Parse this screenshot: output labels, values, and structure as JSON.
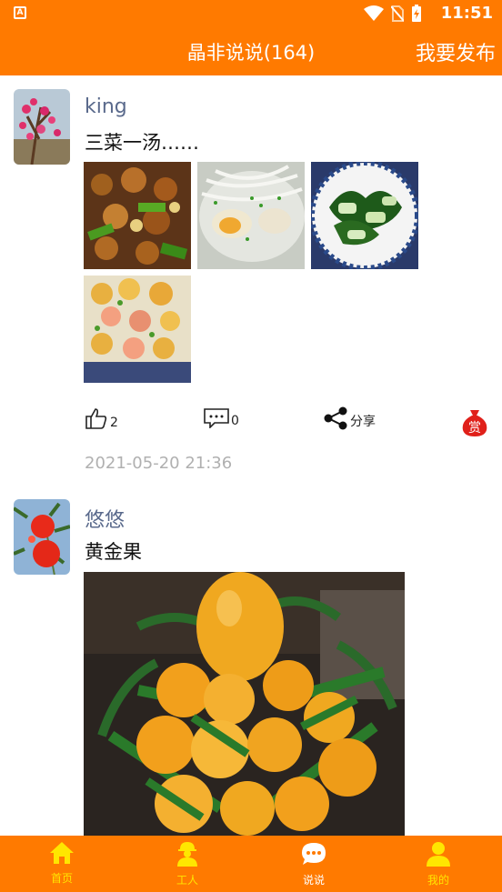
{
  "status_bar": {
    "time": "11:51"
  },
  "header": {
    "title": "晶非说说(164)",
    "publish_label": "我要发布"
  },
  "posts": [
    {
      "username": "king",
      "content": "三菜一汤……",
      "likes": "2",
      "comments": "0",
      "share_label": "分享",
      "reward_label": "赏",
      "timestamp": "2021-05-20 21:36"
    },
    {
      "username": "悠悠",
      "content": "黄金果"
    }
  ],
  "nav": {
    "items": [
      {
        "label": "首页",
        "icon": "home-icon"
      },
      {
        "label": "工人",
        "icon": "worker-icon"
      },
      {
        "label": "说说",
        "icon": "chat-icon"
      },
      {
        "label": "我的",
        "icon": "person-icon"
      }
    ],
    "active": "说说"
  }
}
